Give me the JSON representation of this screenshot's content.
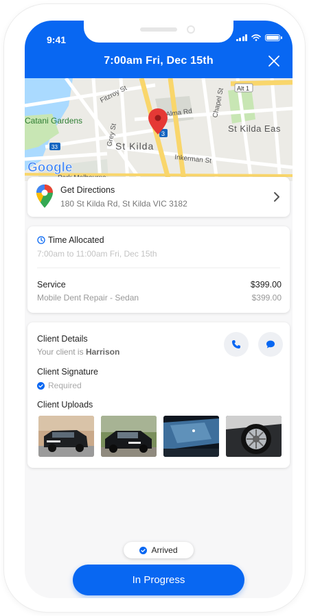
{
  "status_bar": {
    "time": "9:41"
  },
  "header": {
    "title": "7:00am Fri, Dec 15th"
  },
  "map": {
    "labels": {
      "fitzroy": "Fitzroy St",
      "alma": "Alma Rd",
      "chapel": "Chapel St",
      "catani": "Catani Gardens",
      "grey": "Grey St",
      "stkilda": "St Kilda",
      "stkildaeast": "St Kilda Eas",
      "inkerman": "Inkerman St",
      "alt1": "Alt 1",
      "route3": "3",
      "route33": "33",
      "parkmelb": "Park Melbourne",
      "google": "Google"
    }
  },
  "directions": {
    "title": "Get Directions",
    "address": "180 St Kilda Rd, St Kilda VIC 3182"
  },
  "time_card": {
    "title": "Time Allocated",
    "range": "7:00am to 11:00am Fri, Dec 15th",
    "service_label": "Service",
    "service_price": "$399.00",
    "service_name": "Mobile Dent Repair - Sedan",
    "service_subtotal": "$399.00"
  },
  "client_card": {
    "details_title": "Client Details",
    "client_prefix": "Your client is ",
    "client_name": "Harrison",
    "signature_title": "Client Signature",
    "signature_status": "Required",
    "uploads_title": "Client Uploads"
  },
  "footer": {
    "arrived_label": "Arrived",
    "progress_label": "In Progress"
  },
  "colors": {
    "primary": "#0867f2",
    "background": "#f7f7f8",
    "map_pin": "#e53935"
  },
  "icons": [
    "close-icon",
    "map-pin-icon",
    "google-maps-icon",
    "chevron-right-icon",
    "clock-icon",
    "phone-icon",
    "chat-icon",
    "check-circle-icon"
  ]
}
